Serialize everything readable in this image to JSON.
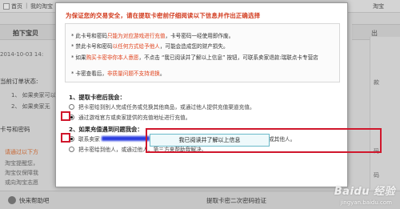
{
  "background": {
    "nav": {
      "home": "首页",
      "separator": "|",
      "my_taobao": "我的淘宝",
      "right_link": "淘宝"
    },
    "header_left": "拍下宝贝",
    "header_right": "出",
    "date": "2014-10-03 14:",
    "order_status_label": "当前订单状态:",
    "status_items": [
      "1、 如果卖家可以",
      "2、 如果卖家无"
    ],
    "card_section_label": "卡号和密码",
    "hint_red": "请通过以下方",
    "hint_lines": [
      "淘宝提醒您，",
      "淘宝仅保障我",
      "或向淘宝志愿"
    ],
    "right_col_lines": [
      "款",
      "码",
      "码"
    ],
    "bottom": {
      "left": "快来帮助吧",
      "mid": "提取卡密二次密码验证"
    }
  },
  "modal": {
    "headline": "为保证您的交易安全，请在提取卡密前仔细阅读以下信息并作出正确选择",
    "notice": [
      {
        "pre": "* 此卡号和密码",
        "red": "只能为对应游戏进行充值",
        "post": "，卡号密码一经使用即作废。"
      },
      {
        "pre": "* 禁此卡号和密码",
        "red": "以任何方式给予他人",
        "post": "，可能会造成您的财产损失。"
      },
      {
        "pre": "* 如果",
        "red": "购买卡密非你本人意愿",
        "post": "，不点击 “我已阅读并了解以上信息” 按钮，可联系卖家退款:瑞联点卡专营店"
      },
      {
        "pre": "",
        "red": "",
        "post": ""
      },
      {
        "pre": "* 卡密查看后，",
        "red": "非质量问题不支持退换",
        "post": "。"
      }
    ],
    "q1": {
      "title": "1、提取卡密后我会：",
      "options": [
        {
          "label": "把卡密给到别人完成任务或兑换其他商品，或通过他人提供充值渠道充值。",
          "selected": false
        },
        {
          "label": "通过游戏官方或卖家提供的充值地址进行充值。",
          "selected": true
        }
      ]
    },
    "q2": {
      "title": "2、如果充值遇到问题我会：",
      "options": [
        {
          "label_pre": "联系卖家",
          "label_post": "协商解决，但在任何情况下都不将卡密透露给卖家或其他人。",
          "selected": true
        },
        {
          "label_pre": "把卡密给到他人，或通过他人、第三方来帮助我解决。",
          "label_post": "",
          "selected": false
        }
      ]
    },
    "confirm_button": "我已阅读并了解以上信息"
  },
  "watermark": {
    "brand": "Baidu 经验",
    "sub": "jingyan.baidu.com"
  },
  "colors": {
    "headline_red": "#d23c1f",
    "frame_red": "#d0172c",
    "button_border": "#6bb9c9"
  }
}
